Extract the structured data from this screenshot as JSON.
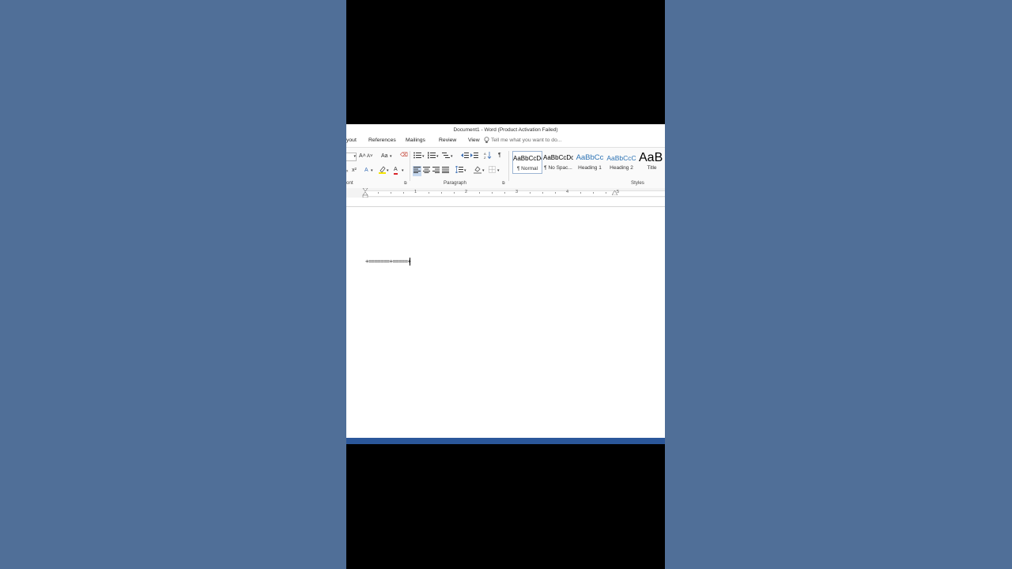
{
  "window": {
    "title": "Document1 - Word (Product Activation Failed)"
  },
  "tabs": [
    {
      "label": "yout"
    },
    {
      "label": "References"
    },
    {
      "label": "Mailings"
    },
    {
      "label": "Review"
    },
    {
      "label": "View"
    }
  ],
  "tell_me": {
    "placeholder": "Tell me what you want to do..."
  },
  "ribbon": {
    "font_group": {
      "label": "ont",
      "grow_font": "A˄",
      "shrink_font": "A˅",
      "change_case": "Aa",
      "superscript": "x²",
      "text_effects": "A",
      "font_color": "A"
    },
    "paragraph_group": {
      "label": "Paragraph",
      "show_marks": "¶"
    },
    "styles_group": {
      "label": "Styles",
      "styles": [
        {
          "sample": "AaBbCcDc",
          "name": "¶ Normal",
          "selected": true,
          "color": "#000000"
        },
        {
          "sample": "AaBbCcDc",
          "name": "¶ No Spac...",
          "selected": false,
          "color": "#000000"
        },
        {
          "sample": "AaBbCc",
          "name": "Heading 1",
          "selected": false,
          "color": "#2e74b5"
        },
        {
          "sample": "AaBbCcC",
          "name": "Heading 2",
          "selected": false,
          "color": "#2e74b5"
        },
        {
          "sample": "AaB",
          "name": "Title",
          "selected": false,
          "color": "#000000"
        }
      ]
    }
  },
  "ruler": {
    "marks": [
      "1",
      "2",
      "3",
      "4",
      "5"
    ]
  },
  "document": {
    "content": "+=======+=====+"
  },
  "colors": {
    "status_bar": "#2b579a",
    "desktop": "#506f98",
    "accent": "#2b579a"
  }
}
